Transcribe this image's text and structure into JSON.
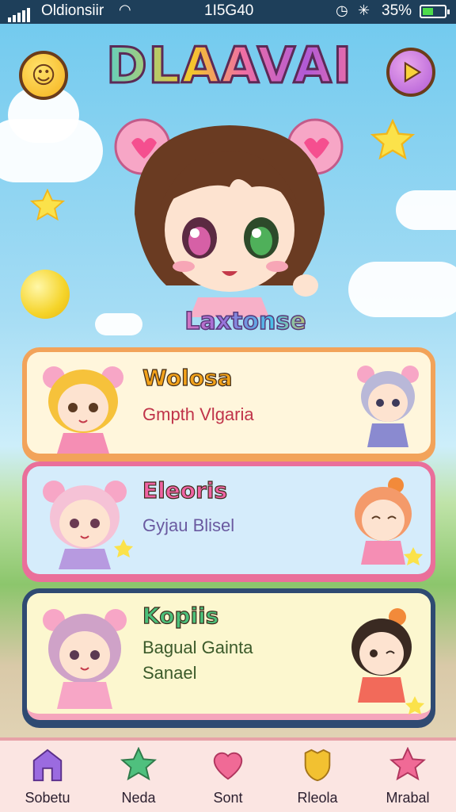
{
  "status_bar": {
    "carrier": "Oldionsiir",
    "time": "1I5G40",
    "battery_percent": "35%",
    "icons": [
      "signal-icon",
      "wifi-icon",
      "alarm-icon",
      "bluetooth-icon",
      "battery-icon"
    ]
  },
  "header": {
    "title": "DLAAVAI",
    "left_button_icon": "smiley-fruit-icon",
    "right_button_icon": "play-icon"
  },
  "hero": {
    "character_label": "Laxtonse"
  },
  "cards": [
    {
      "name": "Wolosa",
      "subtitle_lines": [
        "Gmpth Vlgaria"
      ],
      "name_color": "#f2a21a",
      "subtitle_color": "#c0344a"
    },
    {
      "name": "Eleoris",
      "subtitle_lines": [
        "Gyjau Blisel"
      ],
      "name_color": "#f063a3",
      "subtitle_color": "#6a5aa0"
    },
    {
      "name": "Kopiis",
      "subtitle_lines": [
        "Bagual Gainta",
        "Sanael"
      ],
      "name_color": "#4cc07a",
      "subtitle_color": "#3b5a2a"
    }
  ],
  "nav": [
    {
      "label": "Sobetu",
      "icon": "home-icon",
      "color": "#9b6be0"
    },
    {
      "label": "Neda",
      "icon": "star-icon",
      "color": "#4fc07e"
    },
    {
      "label": "Sont",
      "icon": "heart-icon",
      "color": "#f06a96"
    },
    {
      "label": "Rleola",
      "icon": "shield-icon",
      "color": "#f2c131"
    },
    {
      "label": "Mrabal",
      "icon": "star-icon",
      "color": "#f06a96"
    }
  ],
  "colors": {
    "status_bar_bg": "#1e3f5a",
    "nav_bg": "#fbe5e2",
    "card1_bg": "#fff6dc",
    "card2_bg": "#d5ecfb",
    "card3_bg": "#fcf7cf"
  }
}
